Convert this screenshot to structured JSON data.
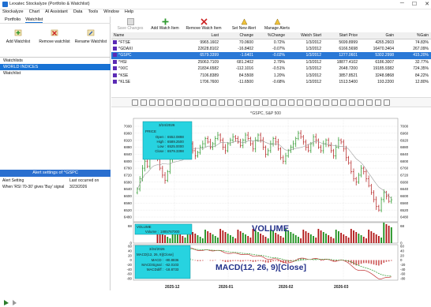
{
  "window": {
    "title": "Lexatec Stockalyze (Portfolio & Watchlist)",
    "min": "─",
    "max": "☐",
    "close": "✕"
  },
  "menu": [
    "Stockalyze",
    "Chart",
    "AI Assistant",
    "Data",
    "Tools",
    "Window",
    "Help"
  ],
  "left_tabs": [
    "Portfolio",
    "Watchlist"
  ],
  "left_toolbar": [
    "Add Watchlist",
    "Remove watchlist",
    "Rename Watchlist"
  ],
  "watchlists": {
    "header": "Watchlists",
    "items": [
      "WORLD INDICES",
      "Watchlist"
    ],
    "selected": 0
  },
  "alerts": {
    "title": "Alert settings of ^GSPC",
    "col1": "Alert Setting",
    "col2": "Last occurred on",
    "rows": [
      {
        "setting": "When 'RSI 70-30' gives 'Buy' signal",
        "date": "3/23/2026"
      }
    ]
  },
  "right_toolbar": [
    "Save Changes",
    "Add Watch Item",
    "Remove Watch Item",
    "Set New Alert",
    "Manage Alerts"
  ],
  "quote_table": {
    "columns": [
      "Name",
      "Last",
      "Change",
      "%Change",
      "Watch Start",
      "Start Price",
      "Gain",
      "%Gain"
    ],
    "rows": [
      [
        "^FTSE",
        "9965.1602",
        "70.0600",
        "0.72%",
        "1/3/2012",
        "5699.8999",
        "4265.2603",
        "74.83%"
      ],
      [
        "^GDAXI",
        "22628.8102",
        "-16.8402",
        "-0.07%",
        "1/3/2012",
        "6166.5698",
        "16470.3404",
        "267.09%"
      ],
      [
        "^GSPC",
        "6579.3399",
        "-1.6401",
        "-0.02%",
        "1/3/2012",
        "1277.0601",
        "5302.2998",
        "415.20%"
      ],
      [
        "^HSI",
        "25063.7109",
        "681.2402",
        "2.79%",
        "1/3/2012",
        "18877.4102",
        "6186.3007",
        "32.77%"
      ],
      [
        "^IXIC",
        "21834.6582",
        "-112.1016",
        "-0.51%",
        "1/3/2012",
        "2648.7200",
        "19185.9382",
        "724.35%"
      ],
      [
        "^KSE",
        "7106.8389",
        "84.5508",
        "1.20%",
        "1/3/2012",
        "3857.8521",
        "3248.9868",
        "84.22%"
      ],
      [
        "^KLSE",
        "1706.7600",
        "-11.6500",
        "-0.68%",
        "1/3/2012",
        "1513.5400",
        "193.2200",
        "12.80%"
      ]
    ],
    "selected": 2
  },
  "chart": {
    "title": "^GSPC, S&P 500",
    "legend": {
      "title": "3/24/2026",
      "series": "PRICE",
      "open_label": "Open",
      "open": "6552.0898",
      "high_label": "High",
      "high": "6589.2500",
      "low_label": "Low",
      "low": "6525.0000",
      "close_label": "Close",
      "close": "6579.3398"
    },
    "vol_legend": {
      "title": "VOLUME",
      "label": "Volume",
      "value": "1885767000"
    },
    "macd_legend": {
      "title": "3/24/2026",
      "series": "MACD(12, 26, 9)[Close]",
      "macd_label": "MACD",
      "macd": "-80.8836",
      "signal_label": "MACDSignal",
      "signal": "-62.0103",
      "diff_label": "MACDdiff",
      "diff": "-18.8733"
    },
    "vol_big_label": "VOLUME",
    "macd_big_label": "MACD(12, 26, 9)[Close]",
    "price_ticks": [
      7000,
      6960,
      6920,
      6880,
      6840,
      6800,
      6760,
      6720,
      6680,
      6640,
      6600,
      6560,
      6520,
      6480
    ],
    "vol_ticks": [
      "68",
      "0"
    ],
    "macd_ticks": [
      60,
      40,
      20,
      0,
      -20,
      -40,
      -60,
      -80
    ],
    "x_labels": [
      "2025-12",
      "2026-01",
      "2026-02",
      "2026-03"
    ],
    "colors": {
      "up": "#1a8f1a",
      "down": "#b01515",
      "sma": "#9a9a9a",
      "label": "#24328a",
      "legend_bg": "#27d3e0"
    }
  }
}
